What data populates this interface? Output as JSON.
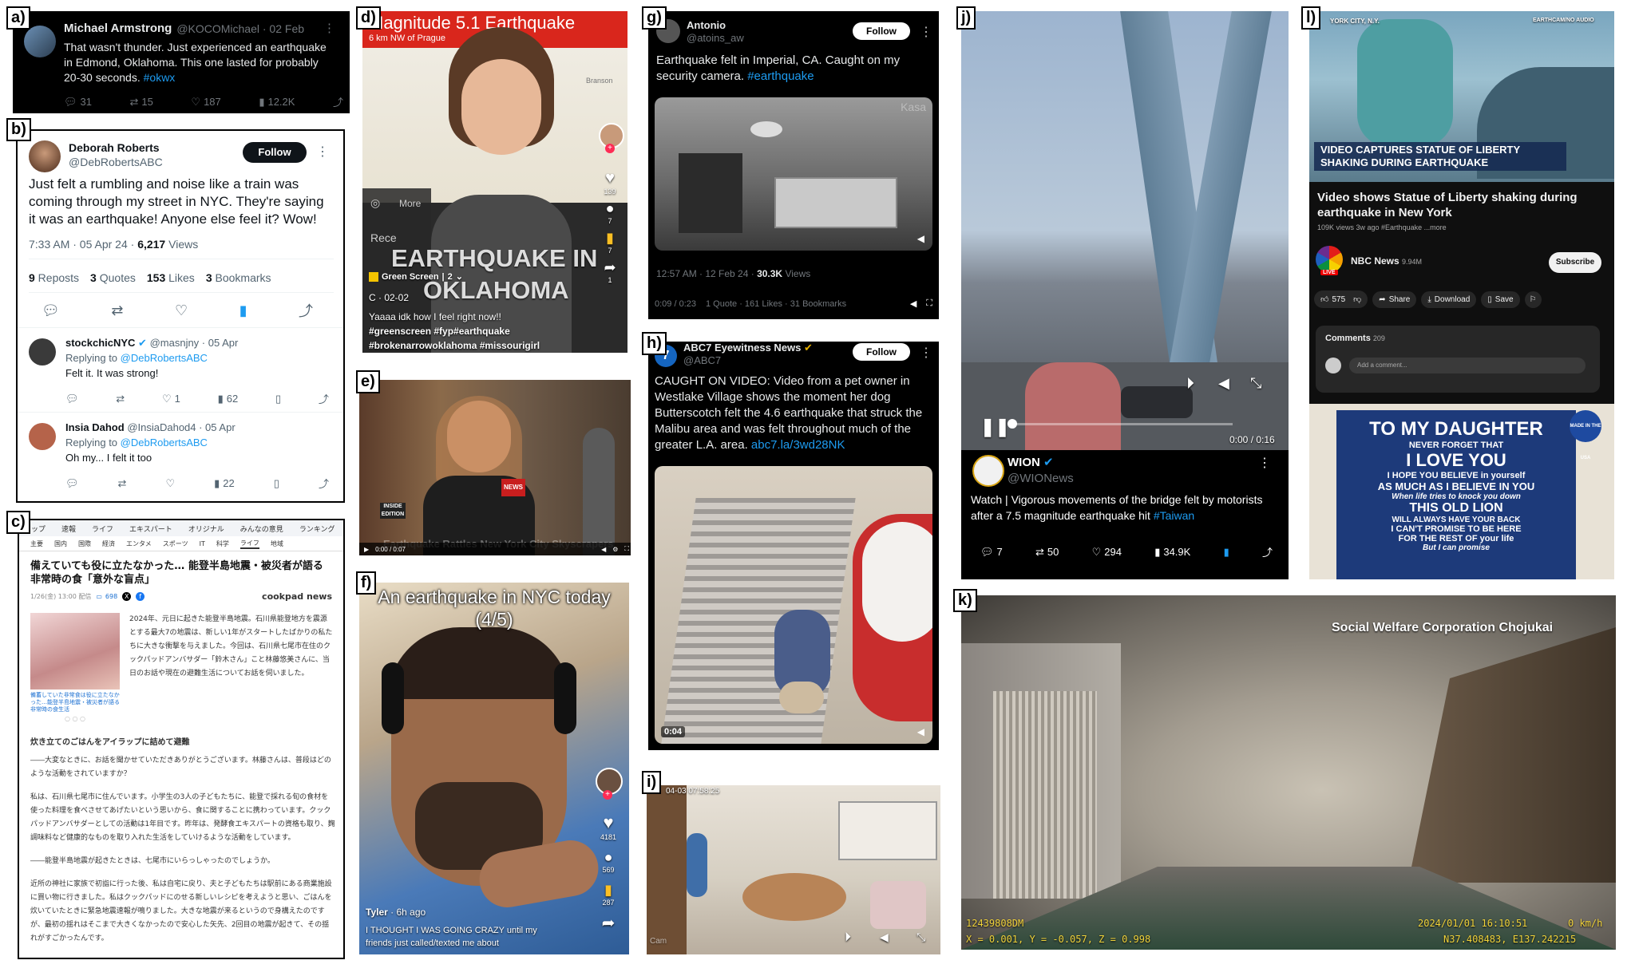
{
  "labels": {
    "a": "a)",
    "b": "b)",
    "c": "c)",
    "d": "d)",
    "e": "e)",
    "f": "f)",
    "g": "g)",
    "h": "h)",
    "i": "i)",
    "j": "j)",
    "k": "k)",
    "l": "l)"
  },
  "a": {
    "name": "Michael Armstrong",
    "handle": "@KOCOMichael · 02 Feb",
    "text": "That wasn't thunder. Just experienced an earthquake in Edmond, Oklahoma. This one lasted for probably 20-30 seconds.",
    "hashtag": "#okwx",
    "replies": "31",
    "reposts": "15",
    "likes": "187",
    "views": "12.2K"
  },
  "b": {
    "name": "Deborah Roberts",
    "handle": "@DebRobertsABC",
    "follow": "Follow",
    "text": "Just felt a rumbling and noise like a train was coming through my street in NYC. They're saying it was an earthquake! Anyone else feel it? Wow!",
    "time": "7:33 AM · 05 Apr 24 · ",
    "views_num": "6,217",
    "views_label": " Views",
    "reposts_num": "9",
    "reposts_label": " Reposts",
    "quotes_num": "3",
    "quotes_label": " Quotes",
    "likes_num": "153",
    "likes_label": " Likes",
    "bookmarks_num": "3",
    "bookmarks_label": " Bookmarks",
    "reply1": {
      "name": "stockchicNYC",
      "handle": "@masnjny · 05 Apr",
      "replying": "Replying to ",
      "to": "@DebRobertsABC",
      "text": "Felt it. It was strong!",
      "likes": "1",
      "views": "62"
    },
    "reply2": {
      "name": "Insia Dahod",
      "handle": "@InsiaDahod4 · 05 Apr",
      "replying": "Replying to ",
      "to": "@DebRobertsABC",
      "text": "Oh my... I felt it too",
      "views": "22"
    }
  },
  "c": {
    "nav": [
      "トップ",
      "速報",
      "ライフ",
      "エキスパート",
      "オリジナル",
      "みんなの意見",
      "ランキング"
    ],
    "subnav": [
      "主要",
      "国内",
      "国際",
      "経済",
      "エンタメ",
      "スポーツ",
      "IT",
      "科学",
      "ライフ",
      "地域"
    ],
    "title": "備えていても役に立たなかった… 能登半島地震・被災者が語る非常時の食「意外な盲点」",
    "meta": "1/26(金) 13:00 配信",
    "comments": "698",
    "source": "cookpad news",
    "para1": "2024年、元日に起きた能登半島地震。石川県能登地方を震源とする最大7の地震は、新しい1年がスタートしたばかりの私たちに大きな衝撃を与えました。今回は、石川県七尾市在住のクックパッドアンバサダー「鈴木さん」こと林藤悠美さんに、当日のお話や現在の避難生活についてお話を伺いました。",
    "caption": "備蓄していた非常食は役に立たなかった…能登半島地震・被災者が語る非常時の食生活",
    "heading": "炊き立てのごはんをアイラップに詰めて避難",
    "qa1": "――大変なときに、お話を聞かせていただきありがとうございます。林藤さんは、普段はどのような活動をされていますか？",
    "para2": "私は、石川県七尾市に住んでいます。小学生の3人の子どもたちに、能登で採れる旬の食材を使った料理を食べさせてあげたいという思いから、食に関することに携わっています。クックパッドアンバサダーとしての活動は1年目です。昨年は、発酵食エキスパートの資格も取り、麹調味料など健康的なものを取り入れた生活をしていけるような活動をしています。",
    "qa2": "――能登半島地震が起きたときは、七尾市にいらっしゃったのでしょうか。",
    "para3": "近所の神社に家族で初詣に行った後、私は自宅に戻り、夫と子どもたちは駅前にある商業施設に買い物に行きました。私はクックパッドにのせる新しいレシピを考えようと思い、ごはんを炊いていたときに緊急地震速報が鳴りました。大きな地震が来るというので身構えたのですが、最初の揺れはそこまで大きくなかったので安心した矢先、2回目の地震が起きて、その揺れがすごかったんです。"
  },
  "d": {
    "title": "Magnitude 5.1 Earthquake",
    "sub": "6 km NW of Prague",
    "banner_line1": "EARTHQUAKE IN",
    "banner_line2": "OKLAHOMA",
    "more": "More",
    "rece": "Rece",
    "green": "Green Screen",
    "count": "2",
    "date": "C · 02-02",
    "caption": "Yaaaa idk how I feel right now!!",
    "tags1": "#greenscreen #fyp#earthquake",
    "tags2": "#brokenarrowoklahoma #missourigirl",
    "likes": "139",
    "comments": "7",
    "saves": "7",
    "shares": "1",
    "place": "Branson"
  },
  "e": {
    "logo": "INSIDE EDITION",
    "mic": "NEWS",
    "time": "0:00 / 0:07",
    "caption": "Earthquake Rattles New York City Skyscrapers"
  },
  "f": {
    "title_line1": "An earthquake  in NYC today",
    "title_line2": "(4/5)",
    "user": "Tyler",
    "time": "· 6h ago",
    "caption_line1": "I THOUGHT I WAS GOING CRAZY until my",
    "caption_line2": "friends just called/texted me about",
    "likes": "4181",
    "comments": "569",
    "saves": "287"
  },
  "g": {
    "name": "Antonio",
    "handle": "@atoins_aw",
    "follow": "Follow",
    "text": "Earthquake felt in Imperial, CA. Caught on my security camera.",
    "hashtag": "#earthquake",
    "watermark": "Kasa",
    "time": "12:57 AM · 12 Feb 24 · ",
    "views_num": "30.3K",
    "views_label": " Views",
    "stats": "0:09 / 0:23",
    "stats2": "1 Quote · 161 Likes · 31 Bookmarks"
  },
  "h": {
    "name": "ABC7 Eyewitness News",
    "handle": "@ABC7",
    "follow": "Follow",
    "text": "CAUGHT ON VIDEO: Video from a pet owner in Westlake Village shows the moment her dog Butterscotch felt the 4.6 earthquake that struck the Malibu area and was felt throughout much of the greater L.A. area.",
    "link": "abc7.la/3wd28NK",
    "logo": "7",
    "duration": "0:04"
  },
  "i": {
    "timestamp": "04-03 07:58:25",
    "watermark": "Cam"
  },
  "j": {
    "time": "0:00 / 0:16",
    "name": "WION",
    "handle": "@WIONews",
    "text": "Watch | Vigorous movements of the bridge felt by motorists after a 7.5 magnitude earthquake hit",
    "hashtag": "#Taiwan",
    "replies": "7",
    "reposts": "50",
    "likes": "294",
    "views": "34.9K"
  },
  "k": {
    "source": "Social Welfare Corporation Chojukai",
    "id": "12439808DM",
    "coords": "X = 0.001, Y = -0.057, Z = 0.998",
    "date": "2024/01/01  16:10:51",
    "speed": "0 km/h",
    "gps": "N37.408483, E137.242215"
  },
  "l": {
    "location": "YORK CITY, N.Y.",
    "credit": "EARTHCAM/NO AUDIO",
    "banner_line1": "VIDEO CAPTURES STATUE OF LIBERTY",
    "banner_line2": "SHAKING DURING EARTHQUAKE",
    "title": "Video shows Statue of Liberty shaking during earthquake in New York",
    "meta": "109K views  3w ago  #Earthquake  ...more",
    "channel": "NBC News",
    "subs": "9.94M",
    "subscribe": "Subscribe",
    "live": "LIVE",
    "likes": "575",
    "share": "Share",
    "download": "Download",
    "save": "Save",
    "comments_label": "Comments",
    "comments_count": "209",
    "add_comment": "Add a comment...",
    "ad_l1": "TO MY DAUGHTER",
    "ad_l2": "NEVER FORGET THAT",
    "ad_l3": "I LOVE YOU",
    "ad_l4": "I HOPE YOU BELIEVE in yourself",
    "ad_l5": "AS MUCH AS I BELIEVE IN YOU",
    "ad_l6": "When life tries to knock you down",
    "ad_l7": "THIS OLD LION",
    "ad_l8": "WILL ALWAYS HAVE YOUR BACK",
    "ad_l9": "I CAN'T PROMISE TO BE HERE",
    "ad_l10": "FOR THE REST OF your life",
    "ad_l11": "But I can promise",
    "ad_badge": "MADE IN THE USA"
  },
  "colors": {
    "x_blue": "#1d9bf0",
    "yt_red": "#ff0000",
    "tiktok_red": "#fe2c55",
    "bookmark_gold": "#ffc107"
  }
}
